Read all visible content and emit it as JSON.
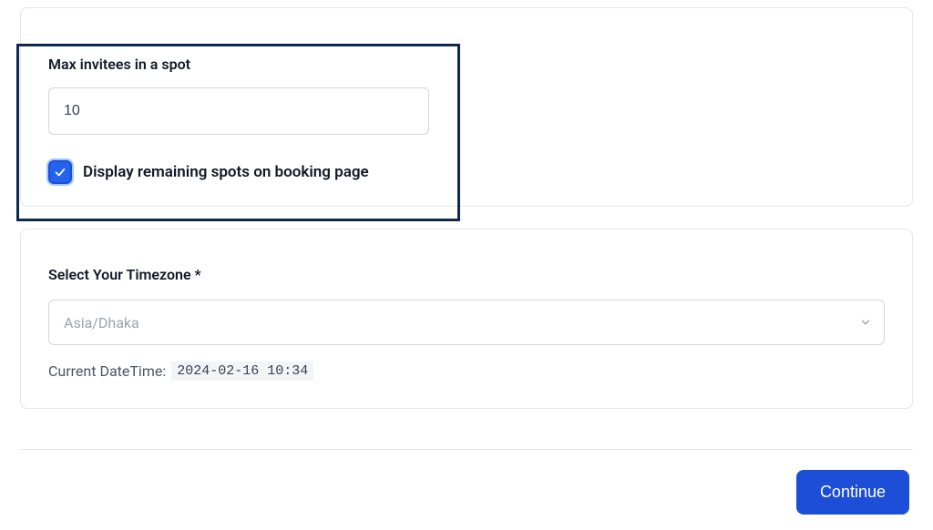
{
  "invitees": {
    "label": "Max invitees in a spot",
    "value": "10",
    "checkbox": {
      "checked": true,
      "label": "Display remaining spots on booking page"
    }
  },
  "timezone": {
    "label": "Select Your Timezone *",
    "selected": "Asia/Dhaka",
    "current_label": "Current DateTime:",
    "current_value": "2024-02-16 10:34"
  },
  "footer": {
    "continue_label": "Continue"
  }
}
